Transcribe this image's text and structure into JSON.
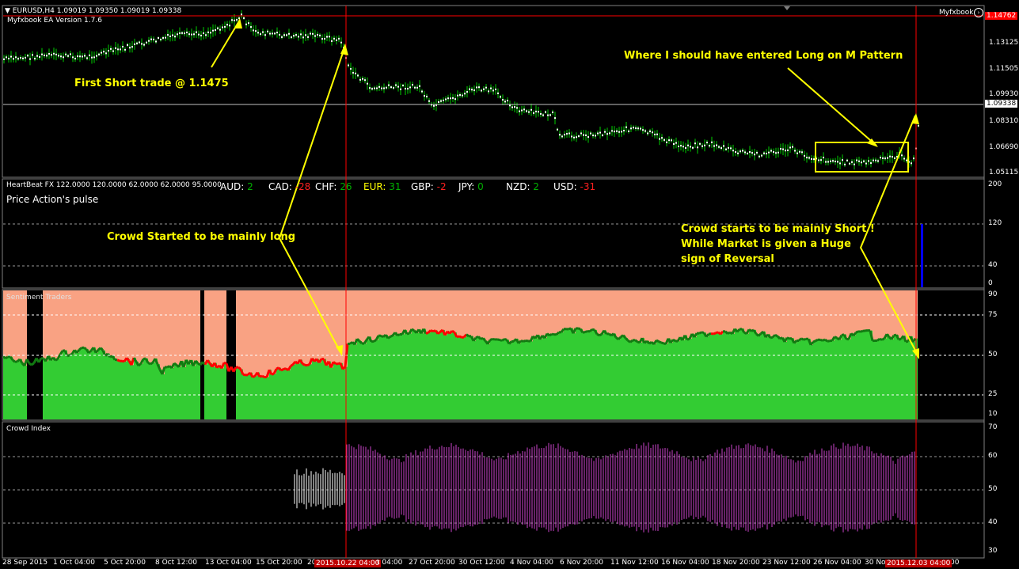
{
  "chart_header": {
    "symbol_info": "EURUSD,H4  1.09019 1.09350 1.09019 1.09338",
    "ea_version": "Myfxbook EA Version 1.7.6",
    "brand": "Myfxbook"
  },
  "indicators": {
    "heartbeat": "HeartBeat FX 122.0000 120.0000 62.0000 62.0000 95.0000",
    "pulse": "Price Action's pulse",
    "sentiment": "Sentiment Traders",
    "crowd": "Crowd Index"
  },
  "currencies": [
    {
      "name": "AUD:",
      "value": "2",
      "value_color": "#00b000"
    },
    {
      "name": "CAD:",
      "value": "-28",
      "value_color": "#ff2020"
    },
    {
      "name": "CHF:",
      "value": "26",
      "value_color": "#00b000"
    },
    {
      "name": "EUR:",
      "value": "31",
      "value_color": "#00b000"
    },
    {
      "name": "GBP:",
      "value": "-2",
      "value_color": "#ff2020"
    },
    {
      "name": "JPY:",
      "value": "0",
      "value_color": "#00b000"
    },
    {
      "name": "NZD:",
      "value": "2",
      "value_color": "#00b000"
    },
    {
      "name": "USD:",
      "value": "-31",
      "value_color": "#ff2020"
    }
  ],
  "price_axis": [
    "1.14762",
    "1.13125",
    "1.11505",
    "1.09930",
    "1.08310",
    "1.06690",
    "1.05115"
  ],
  "current_price": "1.09338",
  "pulse_axis": [
    "200",
    "120",
    "40",
    "0"
  ],
  "sentiment_axis": [
    "90",
    "75",
    "50",
    "25",
    "10"
  ],
  "crowd_axis": [
    "70",
    "60",
    "50",
    "40",
    "30"
  ],
  "time_axis": [
    "28 Sep 2015",
    "1 Oct 04:00",
    "5 Oct 20:00",
    "8 Oct 12:00",
    "13 Oct 04:00",
    "15 Oct 20:00",
    "20",
    "27 Oct 20:00",
    "30 Oct 12:00",
    "4 Nov 04:00",
    "6 Nov 20:00",
    "11 Nov 12:00",
    "16 Nov 04:00",
    "18 Nov 20:00",
    "23 Nov 12:00",
    "26 Nov 04:00",
    "30 No",
    "00"
  ],
  "time_tags": [
    "2015.10.22 04:00",
    "2015.12.03 04:00"
  ],
  "time_tail": "t 04:00",
  "annotations": {
    "first_short": "First Short trade @ 1.1475",
    "m_pattern": "Where I should have entered Long on M Pattern",
    "crowd_long": "Crowd Started to be mainly long",
    "crowd_short_1": "Crowd starts to be mainly Short !",
    "crowd_short_2": "While Market is given a Huge",
    "crowd_short_3": "sign of Reversal"
  },
  "colors": {
    "candles": "#00d000",
    "sentiment_long": "#33cc33",
    "sentiment_short": "#f9a283",
    "sentiment_line_long": "#127a12",
    "sentiment_line_short": "#ff0000",
    "crowd_bars": "#cc44cc",
    "crowd_bars_early": "#ffffff",
    "annotation": "#ffff00",
    "marker_line": "#ff0000",
    "pulse_bar": "#0000ff"
  },
  "pulse_value": 120
}
